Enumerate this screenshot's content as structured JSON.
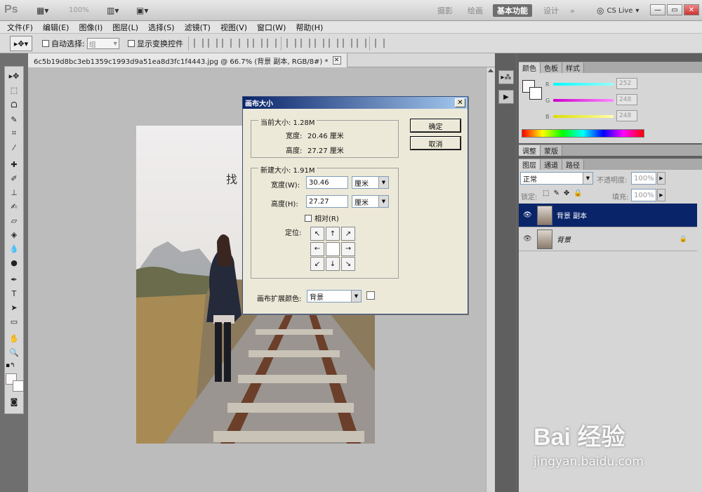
{
  "app": {
    "logo": "Ps",
    "zoom_level": "100%"
  },
  "workspaces": [
    "摄影",
    "绘画",
    "基本功能",
    "设计",
    "»"
  ],
  "cs_live": "CS Live",
  "window_buttons": [
    "—",
    "▭",
    "✕"
  ],
  "menu": [
    "文件(F)",
    "编辑(E)",
    "图像(I)",
    "图层(L)",
    "选择(S)",
    "滤镜(T)",
    "视图(V)",
    "窗口(W)",
    "帮助(H)"
  ],
  "options": {
    "auto_select_label": "自动选择:",
    "auto_select_value": "组",
    "show_transform_label": "显示变换控件"
  },
  "document": {
    "tab_title": "6c5b19d8bc3eb1359c1993d9a51ea8d3fc1f4443.jpg @ 66.7% (背景 副本, RGB/8#) *",
    "tab_close": "✕"
  },
  "panels": {
    "color_tabs": [
      "颜色",
      "色板",
      "样式"
    ],
    "channels": [
      {
        "label": "R",
        "value": "252",
        "color": "#3fd3d8"
      },
      {
        "label": "G",
        "value": "248",
        "color": "#d23fd0"
      },
      {
        "label": "B",
        "value": "248",
        "color": "#e8e23a"
      }
    ],
    "adjust_tabs": [
      "调整",
      "蒙版"
    ],
    "layers_tabs": [
      "图层",
      "通道",
      "路径"
    ],
    "blend_mode": "正常",
    "opacity_label": "不透明度:",
    "opacity_value": "100%",
    "lock_label": "锁定:",
    "fill_label": "填充:",
    "fill_value": "100%",
    "layers": [
      {
        "name": "背景 副本",
        "selected": true
      },
      {
        "name": "背景",
        "selected": false
      }
    ]
  },
  "dialog": {
    "title": "画布大小",
    "current_size_label": "当前大小: 1.28M",
    "width_label": "宽度:",
    "current_width": "20.46 厘米",
    "height_label": "高度:",
    "current_height": "27.27 厘米",
    "new_size_label": "新建大小: 1.91M",
    "new_width_label": "宽度(W):",
    "new_width": "30.46",
    "new_height_label": "高度(H):",
    "new_height": "27.27",
    "unit": "厘米",
    "relative_label": "相对(R)",
    "anchor_label": "定位:",
    "anchors": [
      "↖",
      "↑",
      "↗",
      "←",
      "",
      "→",
      "↙",
      "↓",
      "↘"
    ],
    "ok": "确定",
    "cancel": "取消",
    "ext_color_label": "画布扩展颜色:",
    "ext_color_value": "背景"
  },
  "watermark": {
    "brand": "Bai 经验",
    "url": "jingyan.baidu.com"
  },
  "photo_text": "找"
}
